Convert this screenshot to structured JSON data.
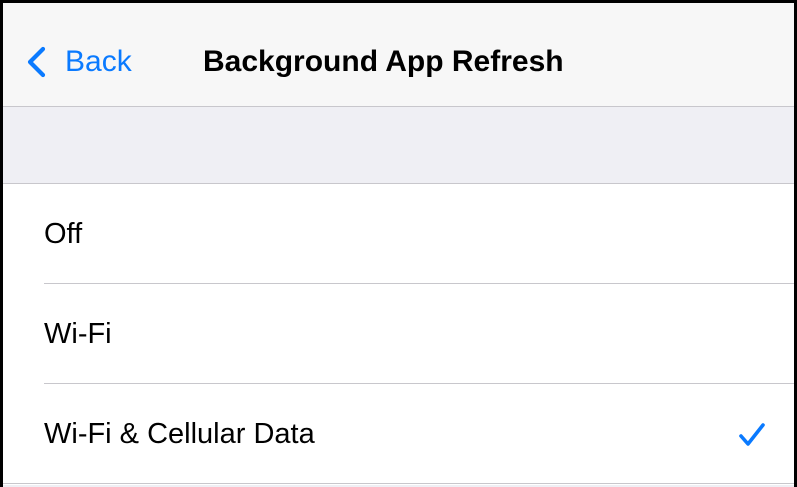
{
  "nav": {
    "back_label": "Back",
    "title": "Background App Refresh"
  },
  "options": [
    {
      "label": "Off",
      "selected": false
    },
    {
      "label": "Wi-Fi",
      "selected": false
    },
    {
      "label": "Wi-Fi & Cellular Data",
      "selected": true
    }
  ],
  "colors": {
    "accent": "#0a7aff",
    "nav_background": "#f7f7f7",
    "group_background": "#efeff4",
    "separator": "#c8c7cc"
  },
  "icons": {
    "back": "chevron-left-icon",
    "selected": "checkmark-icon"
  }
}
